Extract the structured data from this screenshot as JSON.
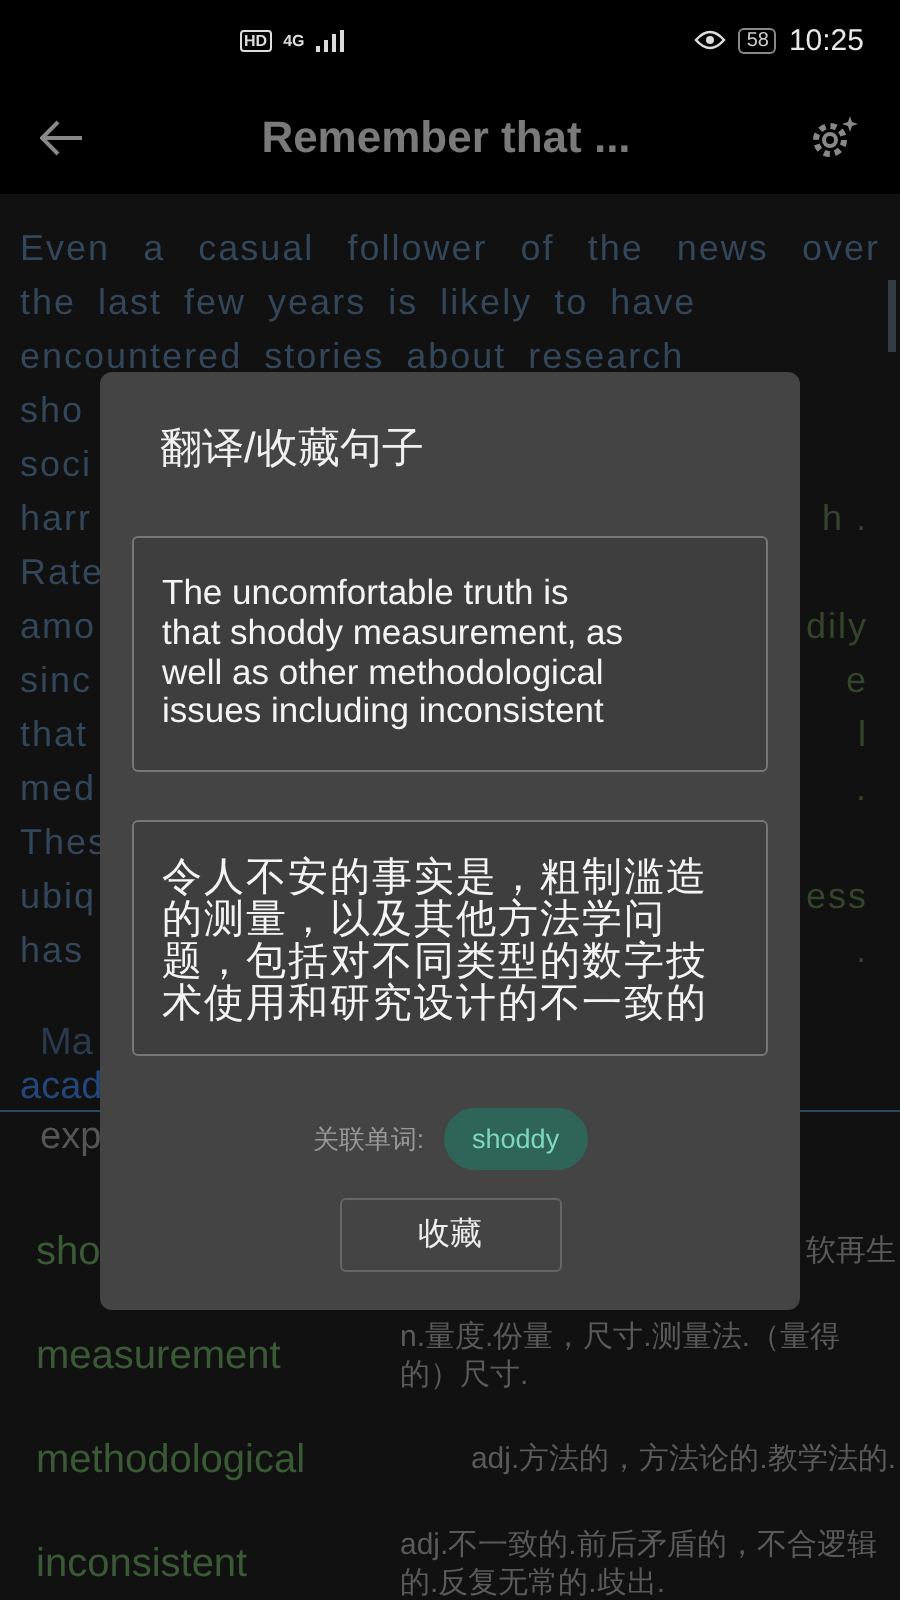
{
  "status_bar": {
    "hd": "HD",
    "network": "4G",
    "time": "10:25",
    "battery": "58"
  },
  "header": {
    "title": "Remember that ..."
  },
  "passage": [
    {
      "left": "Even a casual follower of the news over",
      "justified": true
    },
    {
      "left": "the last few years is likely to have",
      "justified": false
    },
    {
      "left": "encountered stories about research",
      "justified": false
    },
    {
      "left": "sho",
      "justified": false
    },
    {
      "left": "soci",
      "justified": false
    },
    {
      "left": "harr",
      "right": "h .",
      "justified": false
    },
    {
      "left": "Rate",
      "justified": false
    },
    {
      "left": "amo",
      "right": "dily",
      "justified": false
    },
    {
      "left": "sinc",
      "right": "e",
      "justified": false
    },
    {
      "left": "that",
      "right": "l",
      "justified": false
    },
    {
      "left": "med",
      "right": ".",
      "justified": false
    },
    {
      "left": "Thes",
      "justified": false
    },
    {
      "left": "ubiq",
      "right": "ess",
      "justified": false
    },
    {
      "left": "has",
      "right": ".",
      "justified": false
    }
  ],
  "section": {
    "heading": "Ma",
    "subheading": "acad",
    "first_word": "exp"
  },
  "words": [
    {
      "word": "sho",
      "meaning": "软再生"
    },
    {
      "word": "measurement",
      "meaning": "n.量度.份量，尺寸.测量法.（量得的）尺寸."
    },
    {
      "word": "methodological",
      "meaning": "adj.方法的，方法论的.教学法的."
    },
    {
      "word": "inconsistent",
      "meaning": "adj.不一致的.前后矛盾的，不合逻辑的.反复无常的.歧出."
    }
  ],
  "dialog": {
    "title": "翻译/收藏句子",
    "sentence": "The uncomfortable truth is\nthat shoddy measurement, as\nwell as other methodological\nissues  including inconsistent",
    "translation": "令人不安的事实是，粗制滥造的测量，以及其他方法学问题，包括对不同类型的数字技术使用和研究设计的不一致的",
    "related_label": "关联单词:",
    "related_word": "shoddy",
    "button": "收藏"
  }
}
